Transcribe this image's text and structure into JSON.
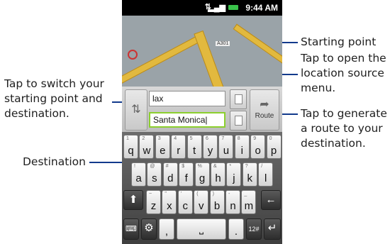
{
  "status_bar": {
    "time": "9:44 AM"
  },
  "map": {
    "road_label": "A301"
  },
  "route_panel": {
    "start_value": "lax",
    "destination_value": "Santa Monica",
    "route_label": "Route"
  },
  "keyboard": {
    "row1": [
      {
        "k": "q",
        "a": "1"
      },
      {
        "k": "w",
        "a": "2"
      },
      {
        "k": "e",
        "a": "3"
      },
      {
        "k": "r",
        "a": "4"
      },
      {
        "k": "t",
        "a": "5"
      },
      {
        "k": "y",
        "a": "6"
      },
      {
        "k": "u",
        "a": "7"
      },
      {
        "k": "i",
        "a": "8"
      },
      {
        "k": "o",
        "a": "9"
      },
      {
        "k": "p",
        "a": "0"
      }
    ],
    "row2": [
      {
        "k": "a",
        "a": "!"
      },
      {
        "k": "s",
        "a": "@"
      },
      {
        "k": "d",
        "a": "#"
      },
      {
        "k": "f",
        "a": "$"
      },
      {
        "k": "g",
        "a": "%"
      },
      {
        "k": "h",
        "a": "&"
      },
      {
        "k": "j",
        "a": "*"
      },
      {
        "k": "k",
        "a": "?"
      },
      {
        "k": "l",
        "a": "/"
      }
    ],
    "row3": [
      {
        "k": "z",
        "a": "~"
      },
      {
        "k": "x",
        "a": "\""
      },
      {
        "k": "c",
        "a": "'"
      },
      {
        "k": "v",
        "a": "("
      },
      {
        "k": "b",
        "a": ")"
      },
      {
        "k": "n",
        "a": "-"
      },
      {
        "k": "m",
        "a": "_"
      }
    ],
    "symbols_label": "12#",
    "comma": ",",
    "period": "."
  },
  "callouts": {
    "switch": "Tap to switch your starting point and destination.",
    "destination": "Destination",
    "starting_point": "Starting point",
    "location_source": "Tap to open the location source menu.",
    "route": "Tap to generate a route to your destination."
  },
  "colors": {
    "callout_line": "#123a8c",
    "destination_border": "#8ccf2e"
  }
}
